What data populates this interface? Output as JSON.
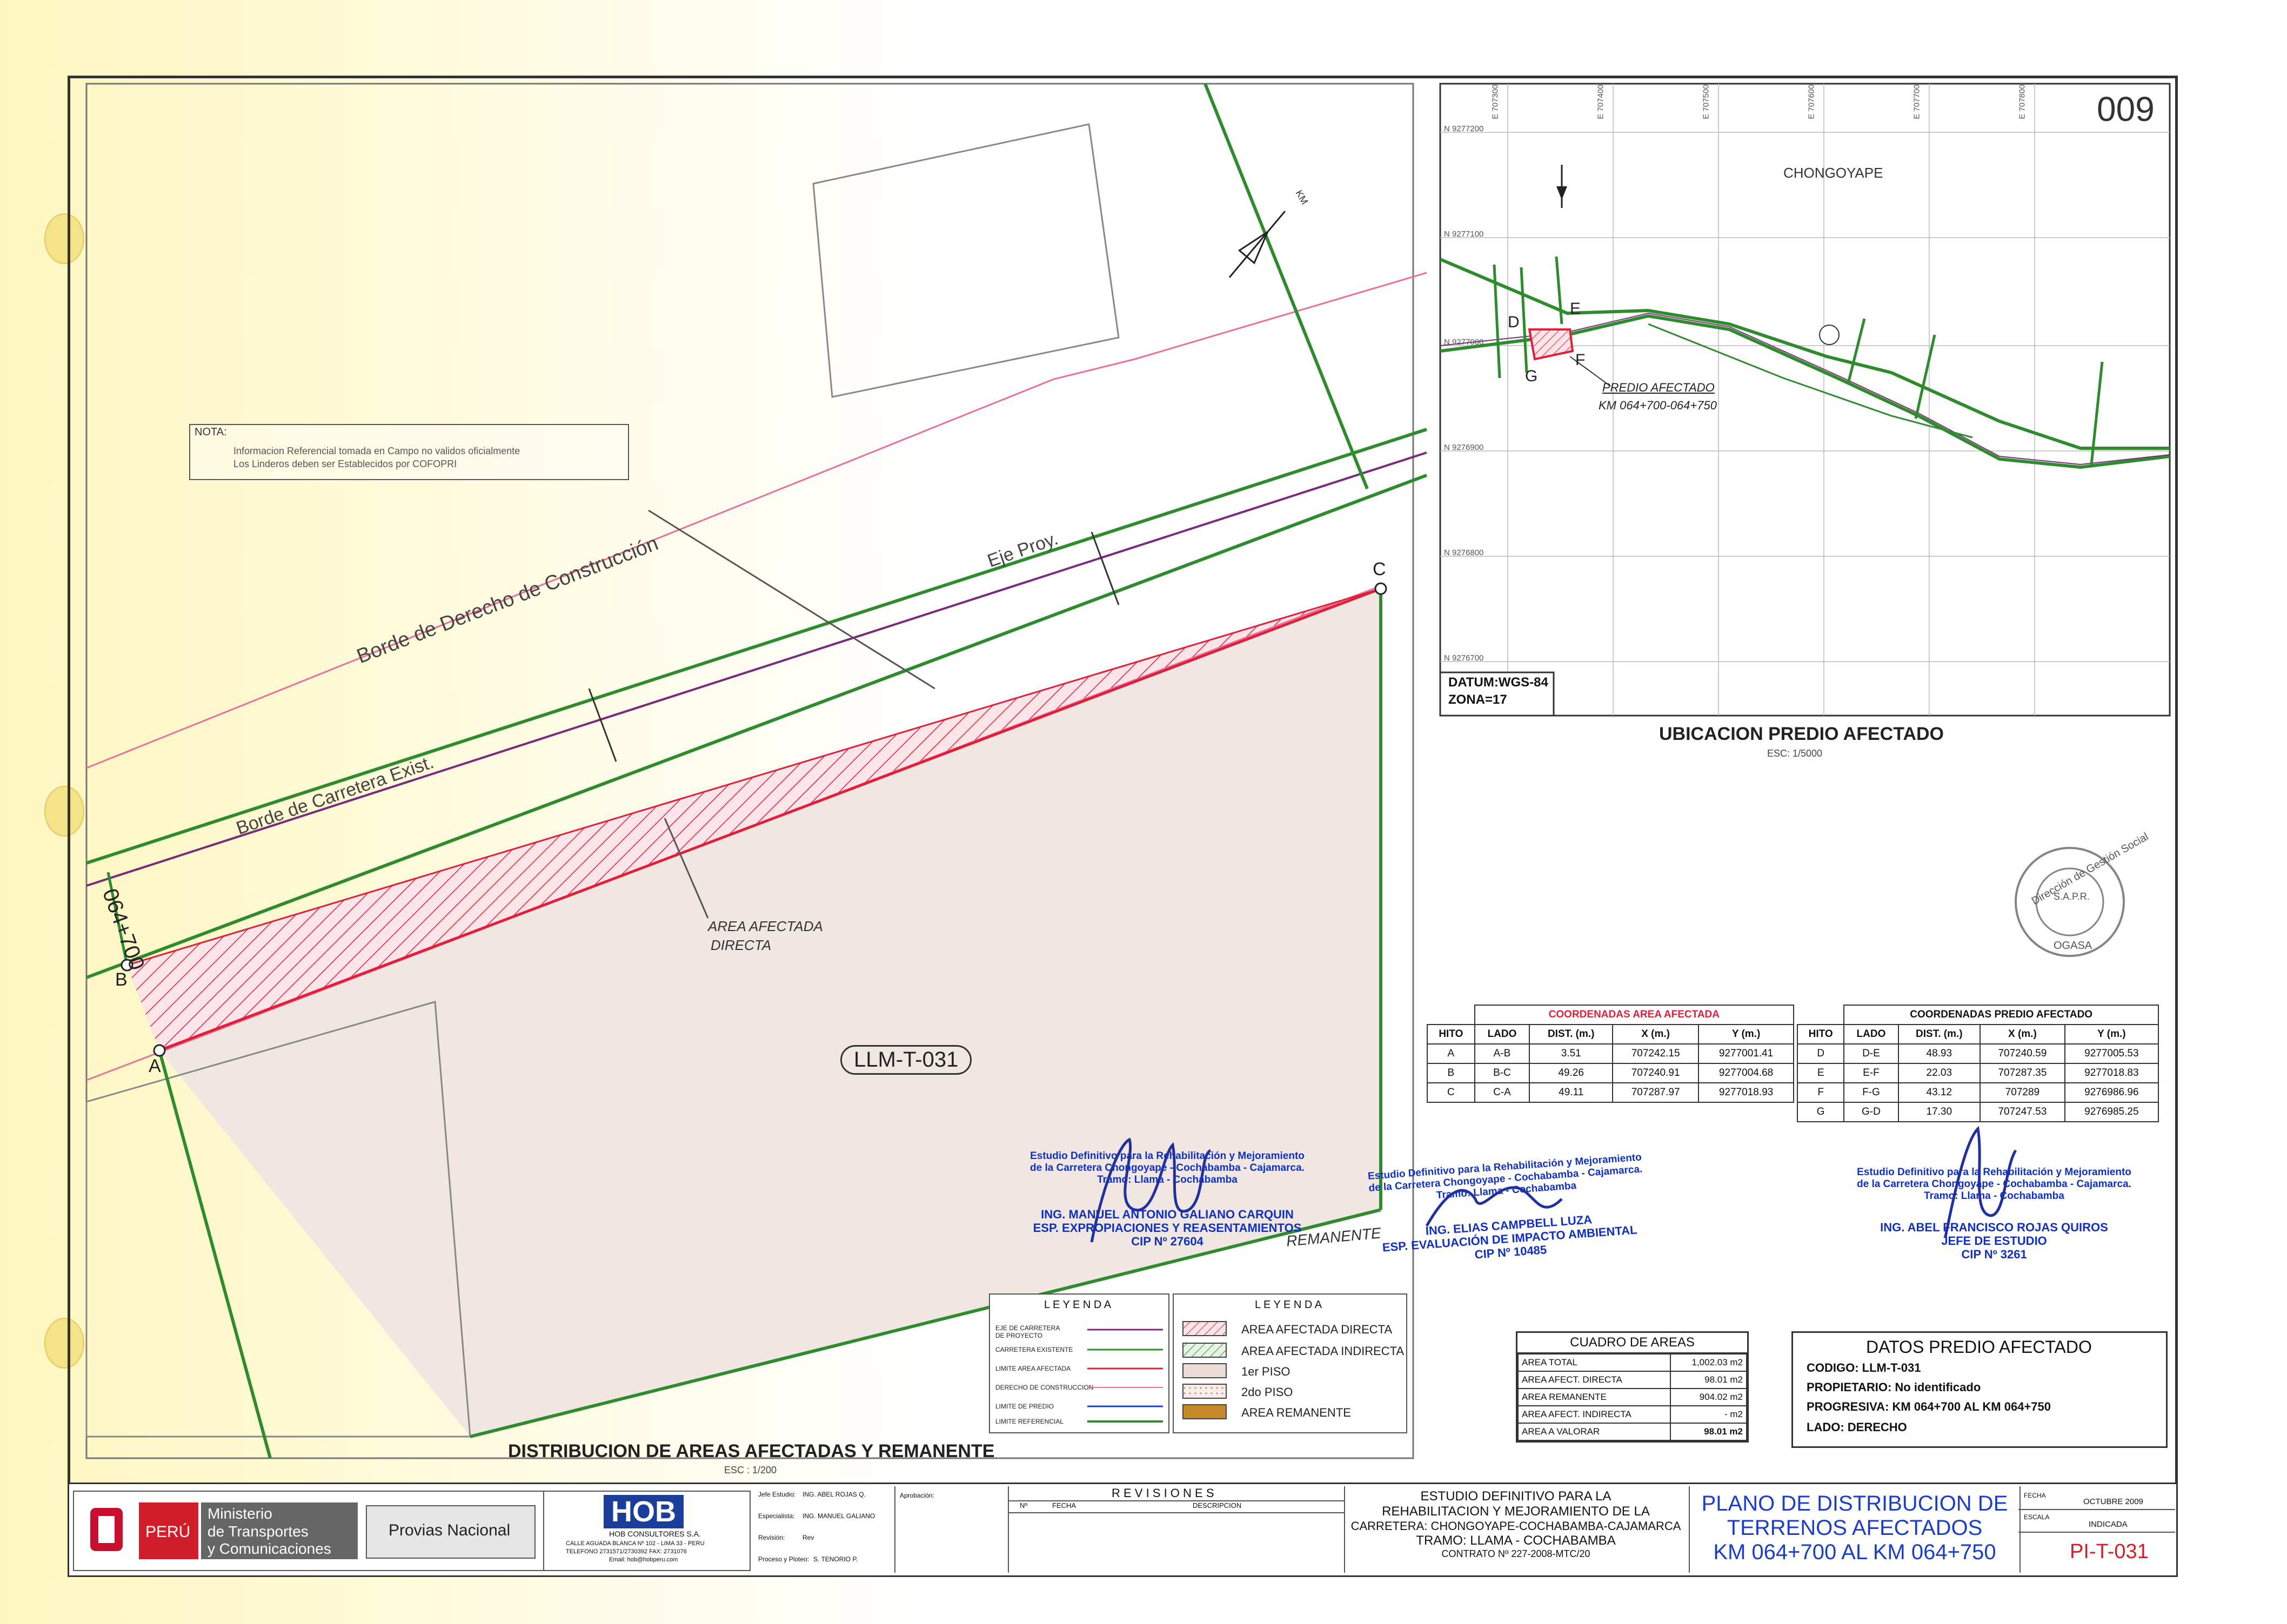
{
  "sheet_number": "009",
  "main_plan": {
    "title": "DISTRIBUCION DE AREAS AFECTADAS Y REMANENTE",
    "scale": "ESC : 1/200",
    "labels": {
      "borde_derecho": "Borde de Derecho de Construcción",
      "borde_carretera": "Borde de Carretera Exist.",
      "eje_proy": "Eje Proy.",
      "progresiva": "064+700",
      "area_afectada": "AREA AFECTADA",
      "directa": "DIRECTA",
      "lote": "LLM-T-031",
      "remanente": "REMANENTE",
      "km": "KM",
      "point_a": "A",
      "point_b": "B",
      "point_c": "C"
    },
    "note": {
      "title": "NOTA:",
      "line1": "Informacion Referencial tomada en Campo no validos oficialmente",
      "line2": "Los Linderos deben ser Establecidos por COFOPRI"
    }
  },
  "location_map": {
    "title": "UBICACION PREDIO AFECTADO",
    "scale": "ESC: 1/5000",
    "town": "CHONGOYAPE",
    "predio_label": "PREDIO AFECTADO",
    "predio_km": "KM 064+700-064+750",
    "datum": "DATUM:WGS-84",
    "zona": "ZONA=17",
    "points": [
      "D",
      "E",
      "F",
      "G"
    ],
    "n_labels": [
      "N 9277200",
      "N 9277100",
      "N 9277000",
      "N 9276900",
      "N 9276800",
      "N 9276700"
    ],
    "e_labels": [
      "E 707300",
      "E 707400",
      "E 707500",
      "E 707600",
      "E 707700",
      "E 707800"
    ]
  },
  "table_area_afectada": {
    "title": "COORDENADAS AREA AFECTADA",
    "headers": [
      "HITO",
      "LADO",
      "DIST. (m.)",
      "X (m.)",
      "Y (m.)"
    ],
    "rows": [
      [
        "A",
        "A-B",
        "3.51",
        "707242.15",
        "9277001.41"
      ],
      [
        "B",
        "B-C",
        "49.26",
        "707240.91",
        "9277004.68"
      ],
      [
        "C",
        "C-A",
        "49.11",
        "707287.97",
        "9277018.93"
      ]
    ],
    "title_color": "#e0203a"
  },
  "table_predio_afectado": {
    "title": "COORDENADAS PREDIO AFECTADO",
    "headers": [
      "HITO",
      "LADO",
      "DIST. (m.)",
      "X (m.)",
      "Y (m.)"
    ],
    "rows": [
      [
        "D",
        "D-E",
        "48.93",
        "707240.59",
        "9277005.53"
      ],
      [
        "E",
        "E-F",
        "22.03",
        "707287.35",
        "9277018.83"
      ],
      [
        "F",
        "F-G",
        "43.12",
        "707289",
        "9276986.96"
      ],
      [
        "G",
        "G-D",
        "17.30",
        "707247.53",
        "9276985.25"
      ]
    ]
  },
  "signatures": [
    {
      "study1": "Estudio Definitivo para la Rehabilitación y Mejoramiento",
      "study2": "de la Carretera Chongoyape - Cochabamba - Cajamarca.",
      "study3": "Tramo: Llama - Cochabamba",
      "name": "ING. MANUEL ANTONIO GALIANO CARQUIN",
      "role": "ESP. EXPROPIACIONES Y REASENTAMIENTOS",
      "cip": "CIP Nº 27604"
    },
    {
      "study1": "Estudio Definitivo para la Rehabilitación y Mejoramiento",
      "study2": "de la Carretera Chongoyape - Cochabamba - Cajamarca.",
      "study3": "Tramo: Llama - Cochabamba",
      "name": "ING. ELIAS CAMPBELL LUZA",
      "role": "ESP. EVALUACIÓN DE IMPACTO AMBIENTAL",
      "cip": "CIP Nº 10485"
    },
    {
      "study1": "Estudio Definitivo para la Rehabilitación y Mejoramiento",
      "study2": "de la Carretera Chongoyape - Cochabamba - Cajamarca.",
      "study3": "Tramo: Llama - Cochabamba",
      "name": "ING. ABEL FRANCISCO ROJAS QUIROS",
      "role": "JEFE DE ESTUDIO",
      "cip": "CIP Nº 3261"
    }
  ],
  "legend_lines": {
    "title": "L E Y E N D A",
    "items": [
      "EJE DE CARRETERA DE PROYECTO",
      "CARRETERA EXISTENTE",
      "LIMITE AREA AFECTADA",
      "DERECHO DE CONSTRUCCION",
      "LIMITE DE PREDIO",
      "LIMITE REFERENCIAL"
    ]
  },
  "legend_fills": {
    "title": "L E Y E N D A",
    "items": [
      "AREA AFECTADA DIRECTA",
      "AREA AFECTADA INDIRECTA",
      "1er PISO",
      "2do PISO",
      "AREA REMANENTE"
    ]
  },
  "cuadro_areas": {
    "title": "CUADRO DE AREAS",
    "rows": [
      [
        "AREA TOTAL",
        "1,002.03 m2"
      ],
      [
        "AREA AFECT. DIRECTA",
        "98.01 m2"
      ],
      [
        "AREA REMANENTE",
        "904.02 m2"
      ],
      [
        "AREA AFECT. INDIRECTA",
        "- m2"
      ],
      [
        "AREA A VALORAR",
        "98.01 m2"
      ]
    ]
  },
  "datos_predio": {
    "title": "DATOS PREDIO AFECTADO",
    "codigo": "CODIGO:  LLM-T-031",
    "propietario": "PROPIETARIO:  No identificado",
    "progresiva": "PROGRESIVA:  KM 064+700  AL  KM 064+750",
    "lado": "LADO:  DERECHO"
  },
  "title_block": {
    "peru": "PERÚ",
    "ministerio1": "Ministerio",
    "ministerio2": "de Transportes",
    "ministerio3": "y Comunicaciones",
    "provias": "Provias Nacional",
    "hob_logo": "HOB",
    "hob_name": "HOB CONSULTORES S.A.",
    "hob_addr1": "CALLE AGUADA BLANCA Nº 102 - LIMA 33 - PERU",
    "hob_addr2": "TELEFONO 2731571/2730392 FAX: 2731076",
    "hob_email": "Email: hob@hobperu.com",
    "jefe_label": "Jefe Estudio:",
    "jefe": "ING. ABEL ROJAS Q.",
    "esp_label": "Especialista:",
    "esp": "ING. MANUEL GALIANO",
    "revision_label": "Revisión:",
    "revision": "Rev",
    "proceso_label": "Proceso y Ploteo:",
    "proceso": "S. TENORIO P.",
    "aprobacion_label": "Aprobación:",
    "revisiones": "R E V I S I O N E S",
    "rev_headers": [
      "Nº",
      "FECHA",
      "DESCRIPCION"
    ],
    "estudio1": "ESTUDIO DEFINITIVO PARA LA",
    "estudio2": "REHABILITACION Y MEJORAMIENTO DE LA",
    "estudio3": "CARRETERA: CHONGOYAPE-COCHABAMBA-CAJAMARCA",
    "estudio4": "TRAMO: LLAMA - COCHABAMBA",
    "contrato": "CONTRATO Nº 227-2008-MTC/20",
    "plano1": "PLANO DE DISTRIBUCION DE",
    "plano2": "TERRENOS AFECTADOS",
    "plano3": "KM 064+700 AL KM 064+750",
    "fecha_label": "FECHA",
    "fecha": "OCTUBRE 2009",
    "escala_label": "ESCALA",
    "escala": "INDICADA",
    "lamina": "PI-T-031"
  },
  "stamp": {
    "outer": "Dirección de Gestión Social",
    "inner1": "S.A.P.R.",
    "inner2": "OGASA"
  },
  "colors": {
    "green": "#2e8b2e",
    "red": "#e0203a",
    "pink": "#e8709a",
    "purple": "#7a2a7a",
    "blue_title": "#1a3ec8",
    "lamina": "#d0202a"
  }
}
